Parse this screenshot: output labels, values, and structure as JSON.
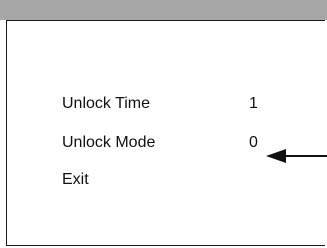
{
  "menu": {
    "items": [
      {
        "label": "Unlock Time",
        "value": "1"
      },
      {
        "label": "Unlock Mode",
        "value": "0"
      },
      {
        "label": "Exit",
        "value": ""
      }
    ]
  },
  "icons": {
    "pointer": "left-arrow-icon"
  },
  "colors": {
    "title_bar": "#a6a6a6",
    "border": "#1a1a1a",
    "text": "#111111"
  }
}
